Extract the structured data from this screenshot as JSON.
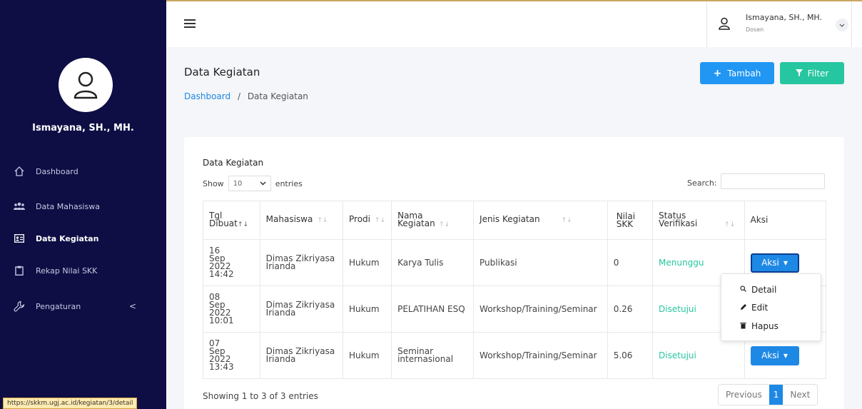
{
  "sidebar": {
    "user_name": "Ismayana, SH., MH.",
    "items": [
      {
        "label": "Dashboard",
        "icon": "home-icon"
      },
      {
        "label": "Data Mahasiswa",
        "icon": "users-icon"
      },
      {
        "label": "Data Kegiatan",
        "icon": "id-card-icon"
      },
      {
        "label": "Rekap Nilai SKK",
        "icon": "clipboard-icon"
      },
      {
        "label": "Pengaturan",
        "icon": "settings-icon"
      }
    ],
    "chevron": "<",
    "status_url": "https://skkm.ugj.ac.id/kegiatan/3/detail"
  },
  "topbar": {
    "user_name": "Ismayana, SH., MH.",
    "user_role": "Dosen"
  },
  "page": {
    "title": "Data Kegiatan",
    "breadcrumb_home": "Dashboard",
    "breadcrumb_sep": "/",
    "breadcrumb_current": "Data Kegiatan",
    "add_button": "Tambah",
    "filter_button": "Filter"
  },
  "table": {
    "title": "Data Kegiatan",
    "show_label": "Show",
    "entries_value": "10",
    "entries_label": "entries",
    "search_label": "Search:",
    "headers": {
      "tgl": "Tgl Dibuat",
      "mahasiswa": "Mahasiswa",
      "prodi": "Prodi",
      "nama": "Nama Kegiatan",
      "jenis": "Jenis Kegiatan",
      "nilai": "Nilai SKK",
      "status": "Status Verifikasi",
      "aksi": "Aksi"
    },
    "rows": [
      {
        "tgl": "16 Sep 2022 14:42",
        "mahasiswa": "Dimas Zikriyasa Irianda",
        "prodi": "Hukum",
        "nama": "Karya Tulis",
        "jenis": "Publikasi",
        "nilai": "0",
        "status": "Menunggu",
        "aksi": "Aksi"
      },
      {
        "tgl": "08 Sep 2022 10:01",
        "mahasiswa": "Dimas Zikriyasa Irianda",
        "prodi": "Hukum",
        "nama": "PELATIHAN ESQ",
        "jenis": "Workshop/Training/Seminar",
        "nilai": "0.26",
        "status": "Disetujui",
        "aksi": "Aksi"
      },
      {
        "tgl": "07 Sep 2022 13:43",
        "mahasiswa": "Dimas Zikriyasa Irianda",
        "prodi": "Hukum",
        "nama": "Seminar internasional",
        "jenis": "Workshop/Training/Seminar",
        "nilai": "5.06",
        "status": "Disetujui",
        "aksi": "Aksi"
      }
    ],
    "dropdown": {
      "detail": "Detail",
      "edit": "Edit",
      "hapus": "Hapus"
    },
    "showing": "Showing 1 to 3 of 3 entries",
    "pager": {
      "previous": "Previous",
      "current": "1",
      "next": "Next"
    }
  },
  "colors": {
    "sidebar_bg": "#0e0e45",
    "primary": "#2196f3",
    "success": "#26c6a0"
  }
}
